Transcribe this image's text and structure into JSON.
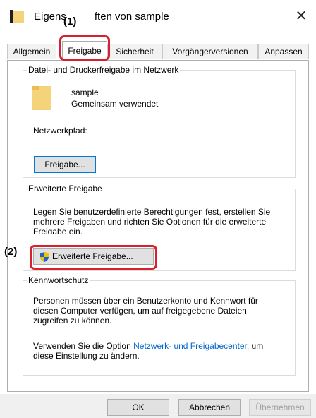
{
  "window": {
    "title_left": "Eigens",
    "title_right": "ften von sample",
    "close_glyph": "✕",
    "folder_icon": "folder-icon"
  },
  "callouts": {
    "one": "(1)",
    "two": "(2)"
  },
  "tabs": [
    {
      "label": "Allgemein",
      "active": false
    },
    {
      "label": "Freigabe",
      "active": true
    },
    {
      "label": "Sicherheit",
      "active": false
    },
    {
      "label": "Vorgängerversionen",
      "active": false
    },
    {
      "label": "Anpassen",
      "active": false
    }
  ],
  "network_share": {
    "legend": "Datei- und Druckerfreigabe im Netzwerk",
    "name": "sample",
    "status": "Gemeinsam verwendet",
    "path_label": "Netzwerkpfad:",
    "share_button": "Freigabe..."
  },
  "advanced_share": {
    "legend": "Erweiterte Freigabe",
    "line1": "Legen Sie benutzerdefinierte Berechtigungen fest, erstellen Sie",
    "line2": "mehrere Freigaben und richten Sie Optionen für die erweiterte",
    "line3": "Freigabe ein.",
    "button": "Erweiterte Freigabe...",
    "button_icon": "shield-icon"
  },
  "password": {
    "legend": "Kennwortschutz",
    "line1": "Personen müssen über ein Benutzerkonto und Kennwort für",
    "line2": "diesen Computer verfügen, um auf freigegebene Dateien",
    "line3": "zugreifen zu können.",
    "line4_prefix": "Verwenden Sie die Option ",
    "link": "Netzwerk- und Freigabecenter",
    "line4_suffix": ", um",
    "line5": "diese Einstellung zu ändern."
  },
  "footer": {
    "ok": "OK",
    "cancel": "Abbrechen",
    "apply": "Übernehmen"
  },
  "colors": {
    "highlight": "#d6212e",
    "link": "#0066cc",
    "focus": "#0078d7",
    "folder": "#f5d37a"
  }
}
